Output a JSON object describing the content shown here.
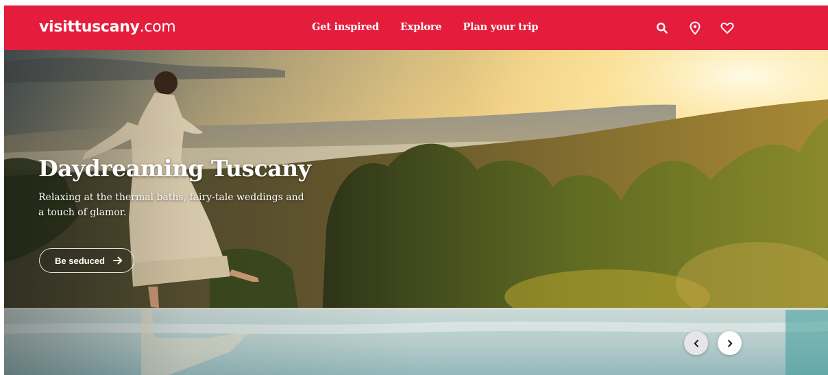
{
  "header": {
    "logo": {
      "brand": "visittuscany",
      "domain": ".com"
    },
    "nav": [
      {
        "label": "Get inspired"
      },
      {
        "label": "Explore"
      },
      {
        "label": "Plan your trip"
      }
    ],
    "icons": [
      "search-icon",
      "location-pin-icon",
      "heart-icon"
    ]
  },
  "hero": {
    "title": "Daydreaming Tuscany",
    "subtitle": "Relaxing at the thermal baths, fairy-tale weddings and a touch of glamor.",
    "cta_label": "Be seduced",
    "carousel": {
      "prev_icon": "chevron-left-icon",
      "next_icon": "chevron-right-icon"
    }
  },
  "colors": {
    "brand_red": "#e41d3c",
    "text_white": "#ffffff",
    "carousel_prev_bg": "#e6e6ea",
    "carousel_next_bg": "#ffffff"
  }
}
